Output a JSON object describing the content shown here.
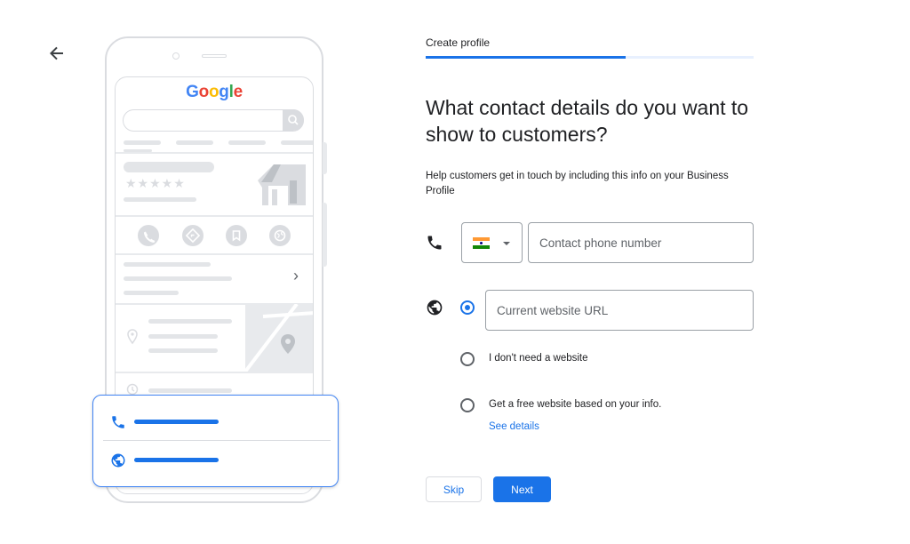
{
  "nav": {
    "back_icon": "arrow-back-icon"
  },
  "illustration": {
    "logo": {
      "letters": [
        {
          "char": "G",
          "color": "#4285f4"
        },
        {
          "char": "o",
          "color": "#ea4335"
        },
        {
          "char": "o",
          "color": "#fbbc05"
        },
        {
          "char": "g",
          "color": "#4285f4"
        },
        {
          "char": "l",
          "color": "#34a853"
        },
        {
          "char": "e",
          "color": "#ea4335"
        }
      ]
    },
    "rating_stars": "★★★★★",
    "chevron": "›",
    "card_icons": [
      "phone-icon",
      "globe-icon"
    ]
  },
  "form": {
    "step_label": "Create profile",
    "progress": 0.61,
    "heading": "What contact details do you want to show to customers?",
    "help_text": "Help customers get in touch by including this info on your Business Profile",
    "phone": {
      "icon": "phone-icon",
      "country": "India",
      "flag_colors": [
        "#ff9933",
        "#ffffff",
        "#138808"
      ],
      "placeholder": "Contact phone number",
      "value": ""
    },
    "website": {
      "icon": "globe-icon",
      "options": [
        {
          "label": "",
          "placeholder": "Current website URL",
          "checked": true
        },
        {
          "label": "I don't need a website",
          "checked": false
        },
        {
          "label": "Get a free website based on your info.",
          "link": "See details",
          "checked": false
        }
      ]
    },
    "buttons": {
      "skip": "Skip",
      "next": "Next"
    },
    "colors": {
      "accent": "#1a73e8"
    }
  }
}
